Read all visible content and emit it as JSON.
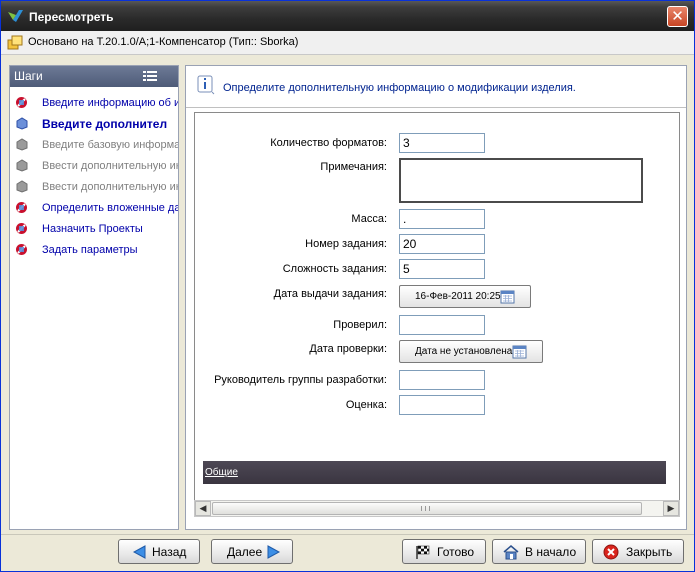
{
  "window": {
    "title": "Пересмотреть",
    "close_glyph": "✕",
    "context_text": "Основано на T.20.1.0/A;1-Компенсатор (Тип:: Sborka)"
  },
  "sidebar": {
    "header": "Шаги",
    "steps": [
      {
        "label": "Введите информацию об и",
        "state": "active",
        "icon": "invalid-step-icon"
      },
      {
        "label": "Введите дополнител",
        "state": "current",
        "icon": "current-step-icon"
      },
      {
        "label": "Введите базовую информа",
        "state": "inactive",
        "icon": "disabled-step-icon"
      },
      {
        "label": "Ввести дополнительную ин",
        "state": "inactive",
        "icon": "disabled-step-icon"
      },
      {
        "label": "Ввести дополнительную ин",
        "state": "inactive",
        "icon": "disabled-step-icon"
      },
      {
        "label": "Определить вложенные да",
        "state": "active",
        "icon": "invalid-step-icon"
      },
      {
        "label": "Назначить Проекты",
        "state": "active",
        "icon": "invalid-step-icon"
      },
      {
        "label": "Задать параметры",
        "state": "active",
        "icon": "invalid-step-icon"
      }
    ]
  },
  "main": {
    "info_text": "Определите дополнительную информацию о модификации изделия.",
    "form": {
      "formats_label": "Количество форматов:",
      "formats_value": "3",
      "notes_label": "Примечания:",
      "notes_value": "",
      "mass_label": "Масса:",
      "mass_value": ".",
      "task_number_label": "Номер задания:",
      "task_number_value": "20",
      "complexity_label": "Сложность задания:",
      "complexity_value": "5",
      "issue_date_label": "Дата выдачи задания:",
      "issue_date_value": "16-Фев-2011 20:25",
      "checked_by_label": "Проверил:",
      "checked_by_value": "",
      "check_date_label": "Дата проверки:",
      "check_date_value": "Дата не установлена.",
      "group_lead_label": "Руководитель группы разработки:",
      "group_lead_value": "",
      "rating_label": "Оценка:",
      "rating_value": ""
    },
    "tab_label": "Общие"
  },
  "footer": {
    "back": "Назад",
    "next": "Далее",
    "finish": "Готово",
    "to_start": "В начало",
    "close": "Закрыть"
  },
  "colors": {
    "link_blue": "#0000aa",
    "info_blue": "#00238f",
    "disabled_gray": "#808080",
    "tab_strip": "#403b47"
  }
}
